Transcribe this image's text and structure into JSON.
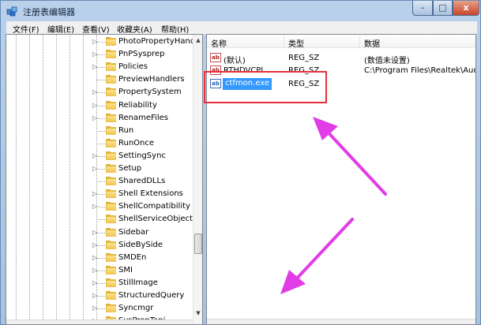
{
  "window": {
    "title": "注册表编辑器",
    "controls": {
      "minimize": "–",
      "maximize": "□",
      "close": "x"
    }
  },
  "menu": [
    "文件(F)",
    "编辑(E)",
    "查看(V)",
    "收藏夹(A)",
    "帮助(H)"
  ],
  "tree": {
    "items": [
      {
        "label": "PhotoPropertyHandle",
        "expandable": true
      },
      {
        "label": "PnPSysprep",
        "expandable": true
      },
      {
        "label": "Policies",
        "expandable": true
      },
      {
        "label": "PreviewHandlers",
        "expandable": false
      },
      {
        "label": "PropertySystem",
        "expandable": true
      },
      {
        "label": "Reliability",
        "expandable": true
      },
      {
        "label": "RenameFiles",
        "expandable": true
      },
      {
        "label": "Run",
        "expandable": false
      },
      {
        "label": "RunOnce",
        "expandable": false
      },
      {
        "label": "SettingSync",
        "expandable": true
      },
      {
        "label": "Setup",
        "expandable": true
      },
      {
        "label": "SharedDLLs",
        "expandable": false
      },
      {
        "label": "Shell Extensions",
        "expandable": true
      },
      {
        "label": "ShellCompatibility",
        "expandable": true
      },
      {
        "label": "ShellServiceObjectDel",
        "expandable": false
      },
      {
        "label": "Sidebar",
        "expandable": true
      },
      {
        "label": "SideBySide",
        "expandable": true
      },
      {
        "label": "SMDEn",
        "expandable": true
      },
      {
        "label": "SMI",
        "expandable": true
      },
      {
        "label": "StillImage",
        "expandable": true
      },
      {
        "label": "StructuredQuery",
        "expandable": true
      },
      {
        "label": "Syncmgr",
        "expandable": true
      },
      {
        "label": "SysPrepTapi",
        "expandable": true
      }
    ]
  },
  "list": {
    "columns": [
      "名称",
      "类型",
      "数据"
    ],
    "rows": [
      {
        "name": "(默认)",
        "type": "REG_SZ",
        "data": "(数值未设置)",
        "selected": false
      },
      {
        "name": "RTHDVCPL",
        "type": "REG_SZ",
        "data": "C:\\Program Files\\Realtek\\Aud",
        "selected": false
      },
      {
        "name": "ctfmon.exe",
        "type": "REG_SZ",
        "data": "",
        "selected": true
      }
    ]
  },
  "icons": {
    "app": "registry-editor-icon",
    "value": "string-value-icon",
    "folder": "folder-icon"
  },
  "colors": {
    "highlight_box": "#e5303c",
    "arrow": "#e23ce6",
    "selection": "#3399ff"
  }
}
